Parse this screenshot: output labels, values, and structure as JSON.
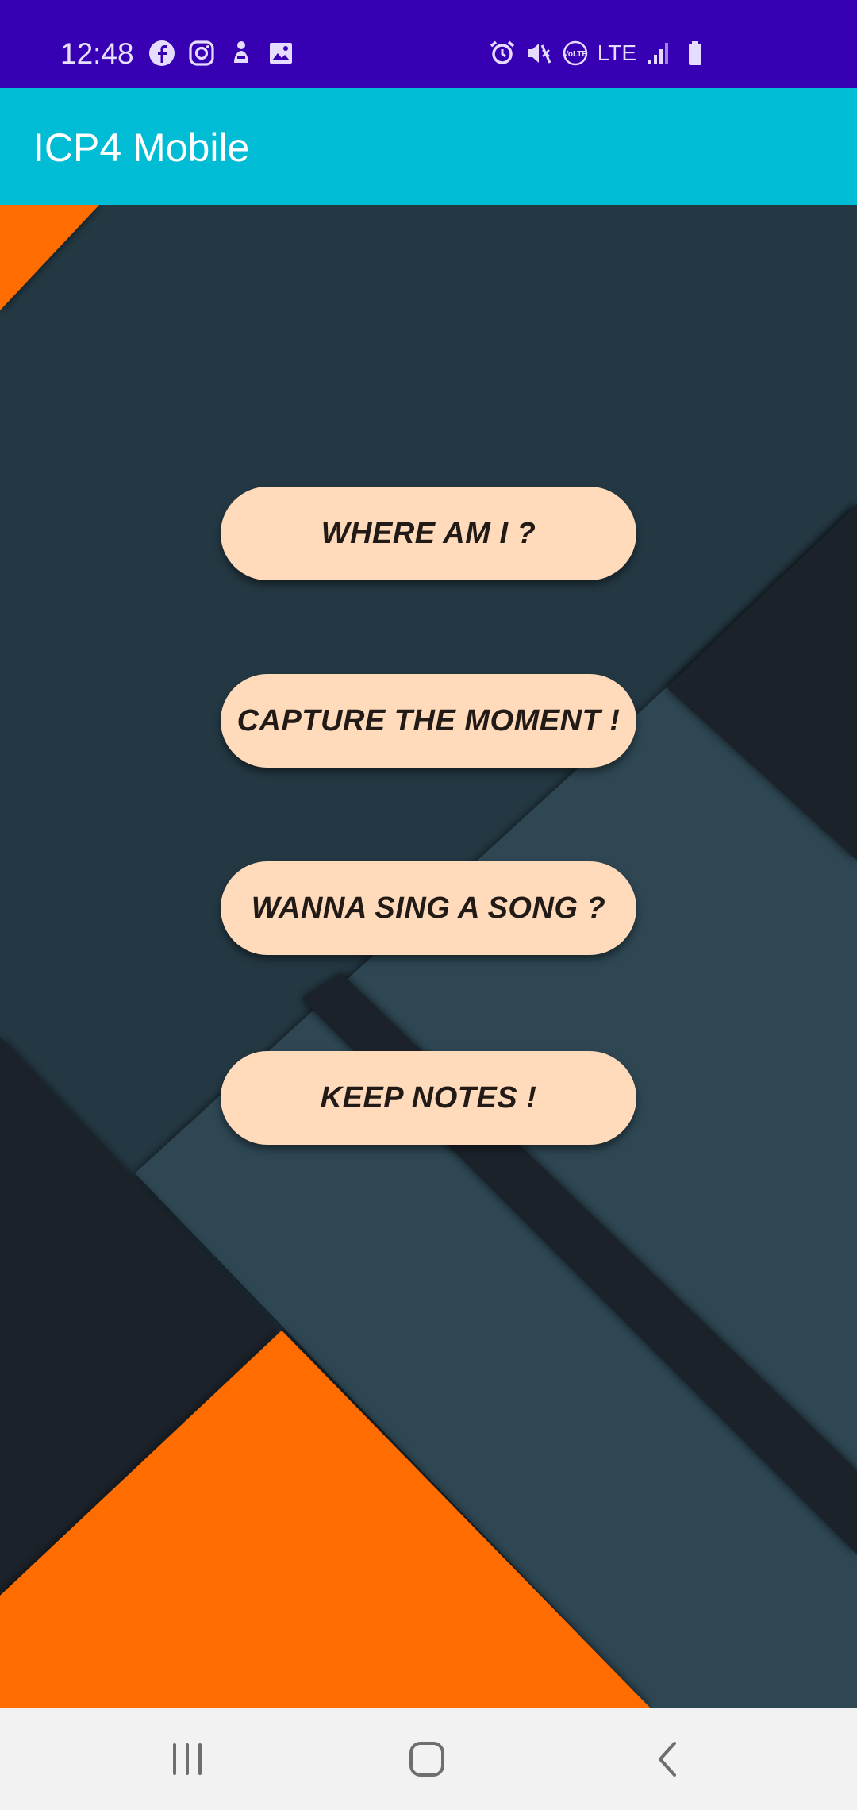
{
  "status_bar": {
    "time": "12:48",
    "left_icons": [
      "facebook-icon",
      "instagram-icon",
      "person-notification-icon",
      "image-icon"
    ],
    "right_icons": [
      "alarm-icon",
      "mute-icon",
      "volte-icon",
      "lte-icon",
      "signal-icon",
      "battery-icon"
    ],
    "lte_label": "LTE",
    "volte_label": "VoLTE"
  },
  "app_bar": {
    "title": "ICP4 Mobile"
  },
  "buttons": {
    "where_am_i": "WHERE AM I ?",
    "capture_moment": "CAPTURE THE MOMENT !",
    "sing_song": "WANNA SING A SONG ?",
    "keep_notes": "KEEP NOTES !"
  },
  "nav_bar": {
    "items": [
      "recent-apps-icon",
      "home-icon",
      "back-icon"
    ]
  },
  "colors": {
    "status_bar": "#3700b3",
    "app_bar": "#00bcd4",
    "button_bg": "#ffdbbb",
    "button_text": "#211a16",
    "bg_dark": "#243843",
    "bg_darker": "#1a242a",
    "bg_slate": "#2f4752",
    "accent_orange": "#ff6d00"
  }
}
